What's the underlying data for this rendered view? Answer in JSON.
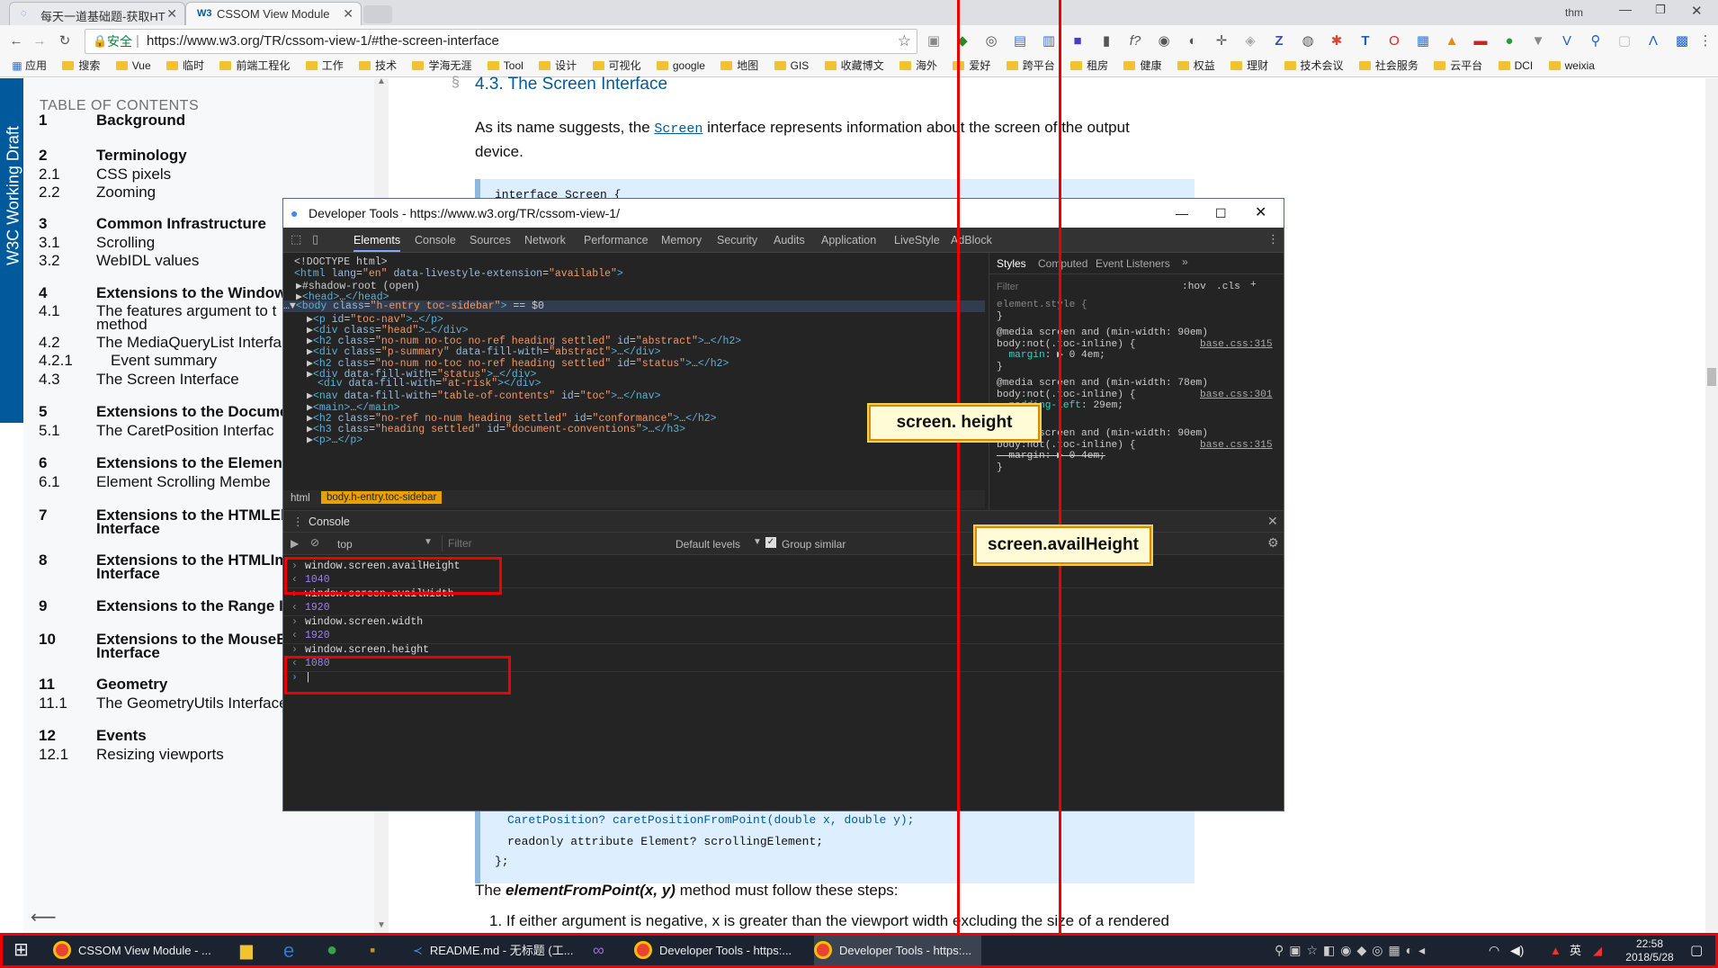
{
  "browser": {
    "tabs": [
      {
        "label": "每天一道基础题-获取HT",
        "active": false
      },
      {
        "label": "CSSOM View Module",
        "active": true,
        "favicon": "W3"
      }
    ],
    "url_secure_label": "安全",
    "url": "https://www.w3.org/TR/cssom-view-1/#the-screen-interface",
    "user_label": "thm",
    "bookmarks": [
      "应用",
      "搜索",
      "Vue",
      "临时",
      "前端工程化",
      "工作",
      "技术",
      "学海无涯",
      "Tool",
      "设计",
      "可视化",
      "google",
      "地图",
      "GIS",
      "收藏博文",
      "海外",
      "爱好",
      "跨平台",
      "租房",
      "健康",
      "权益",
      "理财",
      "技术会议",
      "社会服务",
      "云平台",
      "DCI",
      "weixia"
    ]
  },
  "page": {
    "w3c_label": "W3C Working Draft",
    "toc_title": "TABLE OF CONTENTS",
    "toc": [
      {
        "num": "1",
        "text": "Background",
        "level": "sec"
      },
      {
        "num": "2",
        "text": "Terminology",
        "level": "sec"
      },
      {
        "num": "2.1",
        "text": "CSS pixels",
        "level": "sub"
      },
      {
        "num": "2.2",
        "text": "Zooming",
        "level": "sub"
      },
      {
        "num": "3",
        "text": "Common Infrastructure",
        "level": "sec"
      },
      {
        "num": "3.1",
        "text": "Scrolling",
        "level": "sub"
      },
      {
        "num": "3.2",
        "text": "WebIDL values",
        "level": "sub"
      },
      {
        "num": "4",
        "text": "Extensions to the Window I",
        "level": "sec"
      },
      {
        "num": "4.1",
        "text": "The features argument to t",
        "level": "sub"
      },
      {
        "num": "",
        "text": "method",
        "level": "sub"
      },
      {
        "num": "4.2",
        "text": "The MediaQueryList Interfa",
        "level": "sub"
      },
      {
        "num": "4.2.1",
        "text": "Event summary",
        "level": "sub2"
      },
      {
        "num": "4.3",
        "text": "The Screen Interface",
        "level": "sub"
      },
      {
        "num": "5",
        "text": "Extensions to the Documen",
        "level": "sec"
      },
      {
        "num": "5.1",
        "text": "The CaretPosition Interfac",
        "level": "sub"
      },
      {
        "num": "6",
        "text": "Extensions to the Elemen",
        "level": "sec"
      },
      {
        "num": "6.1",
        "text": "Element Scrolling Membe",
        "level": "sub"
      },
      {
        "num": "7",
        "text": "Extensions to the HTMLEle",
        "level": "sec"
      },
      {
        "num": "",
        "text": "Interface",
        "level": "sec"
      },
      {
        "num": "8",
        "text": "Extensions to the HTMLIma",
        "level": "sec"
      },
      {
        "num": "",
        "text": "Interface",
        "level": "sec"
      },
      {
        "num": "9",
        "text": "Extensions to the Range In",
        "level": "sec"
      },
      {
        "num": "10",
        "text": "Extensions to the MouseEv",
        "level": "sec"
      },
      {
        "num": "",
        "text": "Interface",
        "level": "sec"
      },
      {
        "num": "11",
        "text": "Geometry",
        "level": "sec"
      },
      {
        "num": "11.1",
        "text": "The GeometryUtils Interface",
        "level": "sub"
      },
      {
        "num": "12",
        "text": "Events",
        "level": "sec"
      },
      {
        "num": "12.1",
        "text": "Resizing viewports",
        "level": "sub"
      }
    ],
    "section_marker": "§",
    "heading": "4.3. The Screen Interface",
    "intro_before": "As its name suggests, the",
    "intro_link": "Screen",
    "intro_after": "interface represents information about the screen of the output",
    "intro_line2": "device.",
    "idl_first": "interface Screen {",
    "idl_bottom_1": "CaretPosition? caretPositionFromPoint(double x, double y);",
    "idl_bottom_2": "readonly attribute Element? scrollingElement;",
    "idl_bottom_3": "};",
    "efp_before": "The",
    "efp_method": "elementFromPoint(x, y)",
    "efp_after": "method must follow these steps:",
    "step1": "1. If either argument is negative, x is greater than the viewport width excluding the size of a rendered"
  },
  "devtools": {
    "title": "Developer Tools - https://www.w3.org/TR/cssom-view-1/",
    "tabs": [
      "Elements",
      "Console",
      "Sources",
      "Network",
      "Performance",
      "Memory",
      "Security",
      "Audits",
      "Application",
      "LiveStyle",
      "AdBlock"
    ],
    "active_tab": "Elements",
    "style_tabs": [
      "Styles",
      "Computed",
      "Event Listeners"
    ],
    "filter_placeholder": "Filter",
    "hov": ":hov",
    "cls": ".cls",
    "crumb_html": "html",
    "crumb_body": "body.h-entry.toc-sidebar",
    "console_title": "Console",
    "context": "top",
    "levels": "Default levels",
    "group_similar": "Group similar",
    "console": [
      {
        "cmd": "window.screen.availHeight",
        "res": "1040"
      },
      {
        "cmd": "window.screen.availWidth",
        "res": "1920"
      },
      {
        "cmd": "window.screen.width",
        "res": "1920"
      },
      {
        "cmd": "window.screen.height",
        "res": "1080"
      }
    ]
  },
  "callouts": {
    "height": "screen. height",
    "availHeight": "screen.availHeight"
  },
  "taskbar": {
    "items": [
      "CSSOM View Module - ...",
      "README.md - 无标题 (工...",
      "Developer Tools - https:...",
      "Developer Tools - https:..."
    ],
    "ime": "英",
    "time": "22:58",
    "date": "2018/5/28"
  }
}
